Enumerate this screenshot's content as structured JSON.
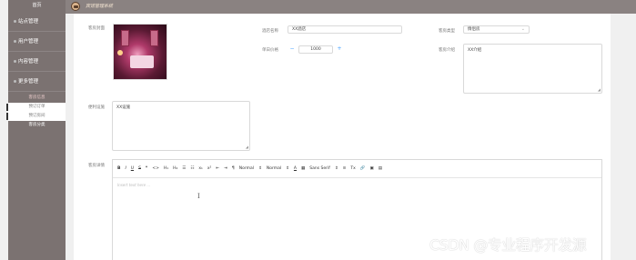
{
  "sidebar": {
    "home": "首页",
    "menus": [
      {
        "label": "站点管理"
      },
      {
        "label": "用户管理"
      },
      {
        "label": "内容管理"
      },
      {
        "label": "更多管理"
      }
    ],
    "section_title": "客房信息",
    "submenus": [
      {
        "label": "预订订单",
        "active": true
      },
      {
        "label": "预订房间",
        "active": true
      },
      {
        "label": "客房分类",
        "active": false
      }
    ]
  },
  "header": {
    "title": "宾馆管理系统"
  },
  "form": {
    "cover_label": "客房封面",
    "hotel_name_label": "酒店名称",
    "hotel_name_value": "XX酒店",
    "room_type_label": "客房类型",
    "room_type_value": "情侣房",
    "price_label": "单日价格",
    "price_value": "1000",
    "minus": "−",
    "plus": "+",
    "intro_label": "客房介绍",
    "intro_value": "XX介绍",
    "facilities_label": "便利设施",
    "facilities_value": "XX设施",
    "details_label": "客房详情",
    "toolbar": [
      "B",
      "I",
      "U",
      "S",
      "❞",
      "<>",
      "H₁",
      "H₂",
      "☰",
      "☷",
      "x₁",
      "x²",
      "⇤",
      "⇥",
      "¶",
      "Normal",
      "⇕",
      "Normal",
      "⇕",
      "A",
      "▦",
      "Sans Serif",
      "⇕",
      "≡",
      "Tx",
      "🔗",
      "▣",
      "▤"
    ],
    "editor_placeholder": "Insert text here ...",
    "cursor": "I"
  },
  "watermark": "CSDN @专业程序开发源"
}
